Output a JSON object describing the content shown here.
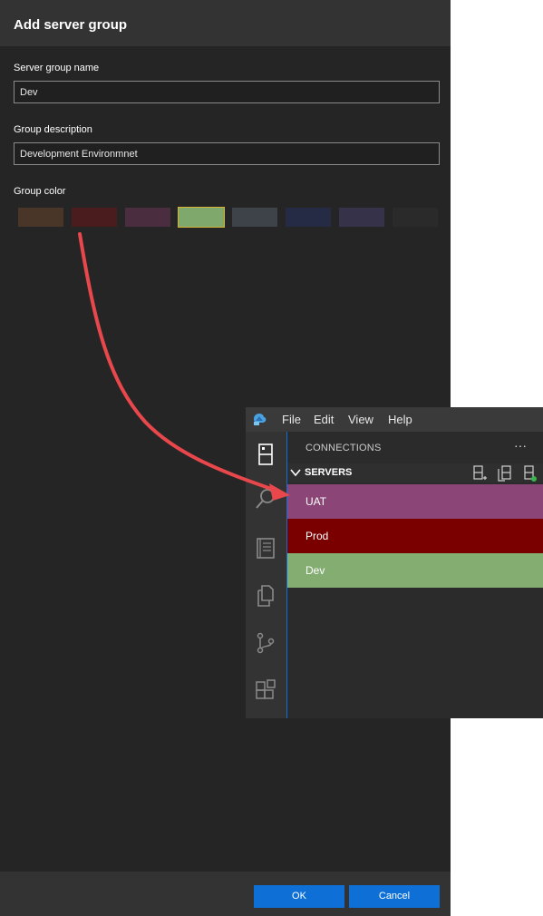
{
  "dialog": {
    "title": "Add server group",
    "name_label": "Server group name",
    "name_value": "Dev",
    "description_label": "Group description",
    "description_value": "Development Environmnet",
    "color_label": "Group color",
    "colors": [
      "#4a3529",
      "#4a1c1e",
      "#4a2d3e",
      "#7fa86c",
      "#3e4349",
      "#262b45",
      "#363249",
      "#2a2a2a"
    ],
    "selected_color_index": 3,
    "ok_label": "OK",
    "cancel_label": "Cancel"
  },
  "ads": {
    "menu": [
      "File",
      "Edit",
      "View",
      "Help"
    ],
    "connections_title": "CONNECTIONS",
    "more_label": "···",
    "servers_label": "SERVERS",
    "activity_icons": [
      "connections-icon",
      "search-icon",
      "notebook-icon",
      "explorer-icon",
      "source-control-icon",
      "extensions-icon"
    ],
    "groups": [
      {
        "label": "UAT",
        "color": "#8b4577"
      },
      {
        "label": "Prod",
        "color": "#7a0000"
      },
      {
        "label": "Dev",
        "color": "#84ad72"
      }
    ]
  },
  "colors": {
    "accent": "#0e70d6",
    "annotation_arrow": "#e8474b"
  }
}
